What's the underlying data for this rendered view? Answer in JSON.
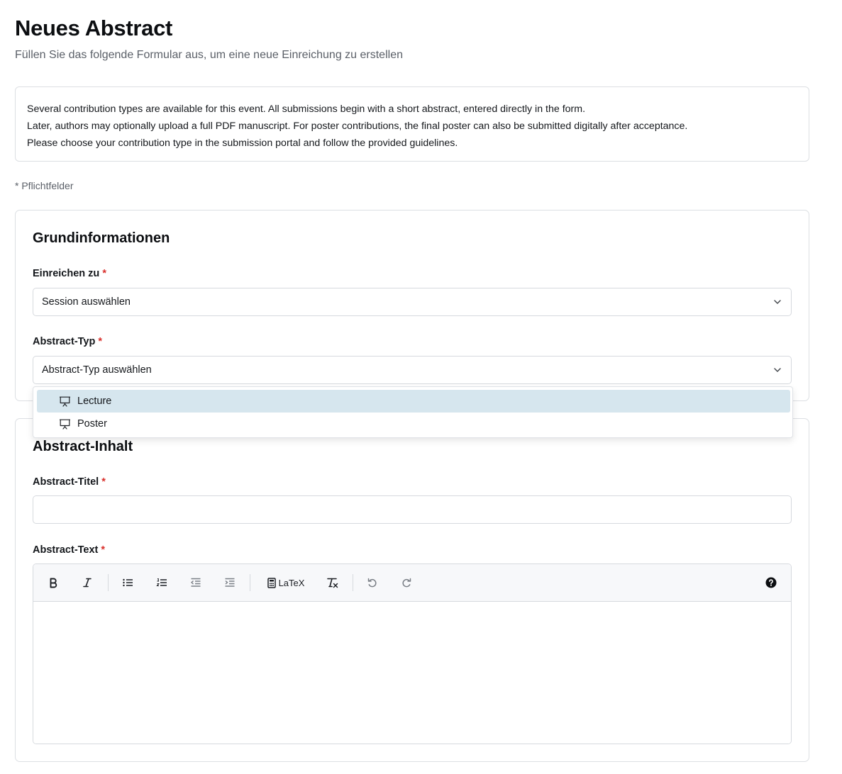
{
  "header": {
    "title": "Neues Abstract",
    "subtitle": "Füllen Sie das folgende Formular aus, um eine neue Einreichung zu erstellen"
  },
  "info": {
    "lines": [
      "Several contribution types are available for this event. All submissions begin with a short abstract, entered directly in the form.",
      "Later, authors may optionally upload a full PDF manuscript. For poster contributions, the final poster can also be submitted digitally after acceptance.",
      "Please choose your contribution type in the submission portal and follow the provided guidelines."
    ]
  },
  "required_note": "* Pflichtfelder",
  "basic_info": {
    "title": "Grundinformationen",
    "submit_to": {
      "label": "Einreichen zu",
      "required_mark": "*",
      "value": "Session auswählen"
    },
    "abstract_type": {
      "label": "Abstract-Typ",
      "required_mark": "*",
      "value": "Abstract-Typ auswählen",
      "options": [
        {
          "label": "Lecture",
          "icon": "presentation-icon",
          "highlighted": true
        },
        {
          "label": "Poster",
          "icon": "presentation-icon",
          "highlighted": false
        }
      ]
    }
  },
  "content": {
    "title": "Abstract-Inhalt",
    "abstract_title": {
      "label": "Abstract-Titel",
      "required_mark": "*",
      "value": ""
    },
    "abstract_text": {
      "label": "Abstract-Text",
      "required_mark": "*",
      "toolbar": {
        "latex_label": "LaTeX",
        "buttons": [
          "bold-icon",
          "italic-icon",
          "bullet-list-icon",
          "numbered-list-icon",
          "outdent-icon",
          "indent-icon",
          "calculator-icon",
          "clear-format-icon",
          "undo-icon",
          "redo-icon",
          "help-icon"
        ]
      },
      "value": ""
    }
  },
  "colors": {
    "required": "#d9302c",
    "option_highlight": "#d6e6ee",
    "border": "#dcdfe3",
    "toolbar_bg": "#f7f8fa"
  }
}
